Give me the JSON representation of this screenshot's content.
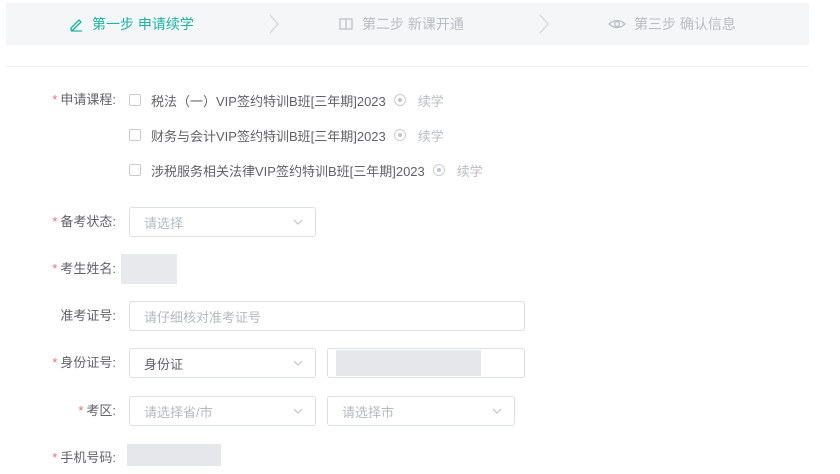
{
  "steps": [
    {
      "label": "第一步 申请续学",
      "icon": "pencil-icon",
      "active": true
    },
    {
      "label": "第二步 新课开通",
      "icon": "book-icon",
      "active": false
    },
    {
      "label": "第三步 确认信息",
      "icon": "eye-icon",
      "active": false
    }
  ],
  "colors": {
    "accent": "#1bb3a6",
    "required": "#f56c6c",
    "border": "#dcdfe6"
  },
  "form": {
    "course": {
      "label": "申请课程:",
      "options": [
        {
          "name": "税法（一）VIP签约特训B班[三年期]2023",
          "radio_label": "续学"
        },
        {
          "name": "财务与会计VIP签约特训B班[三年期]2023",
          "radio_label": "续学"
        },
        {
          "name": "涉税服务相关法律VIP签约特训B班[三年期]2023",
          "radio_label": "续学"
        }
      ]
    },
    "exam_status": {
      "label": "备考状态:",
      "placeholder": "请选择"
    },
    "name": {
      "label": "考生姓名:"
    },
    "ticket": {
      "label": "准考证号:",
      "placeholder": "请仔细核对准考证号"
    },
    "id": {
      "label": "身份证号:",
      "type_value": "身份证"
    },
    "region": {
      "label": "考区:",
      "province_placeholder": "请选择省/市",
      "city_placeholder": "请选择市"
    },
    "phone": {
      "label": "手机号码:"
    }
  }
}
